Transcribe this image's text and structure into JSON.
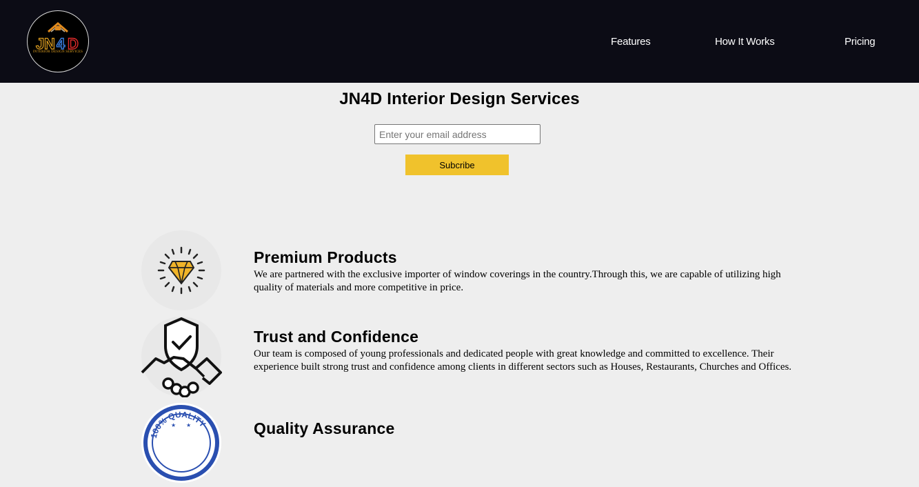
{
  "header": {
    "logo": {
      "mark": "JN4D",
      "subtitle": "INTERIOR DESIGN SERVICES"
    },
    "nav": [
      {
        "label": "Features"
      },
      {
        "label": "How It Works"
      },
      {
        "label": "Pricing"
      }
    ]
  },
  "hero": {
    "title": "JN4D Interior Design Services",
    "email_placeholder": "Enter your email address",
    "email_value": "",
    "subscribe_label": "Subcribe"
  },
  "features": [
    {
      "icon": "diamond-icon",
      "title": "Premium Products",
      "text": "We are partnered with the exclusive importer of window coverings in the country.Through this, we are capable of utilizing high quality of materials and more competitive in price."
    },
    {
      "icon": "handshake-shield-icon",
      "title": "Trust and Confidence",
      "text": "Our team is composed of young professionals and dedicated people with great knowledge and committed to excellence. Their experience built strong trust and confidence among clients in different sectors such as Houses, Restaurants, Churches and Offices."
    },
    {
      "icon": "quality-seal-icon",
      "icon_text": "100% QUALITY",
      "title": "Quality Assurance",
      "text": ""
    }
  ],
  "colors": {
    "header_bg": "#0c0c15",
    "page_bg": "#eeeeee",
    "accent": "#f0c22c"
  }
}
